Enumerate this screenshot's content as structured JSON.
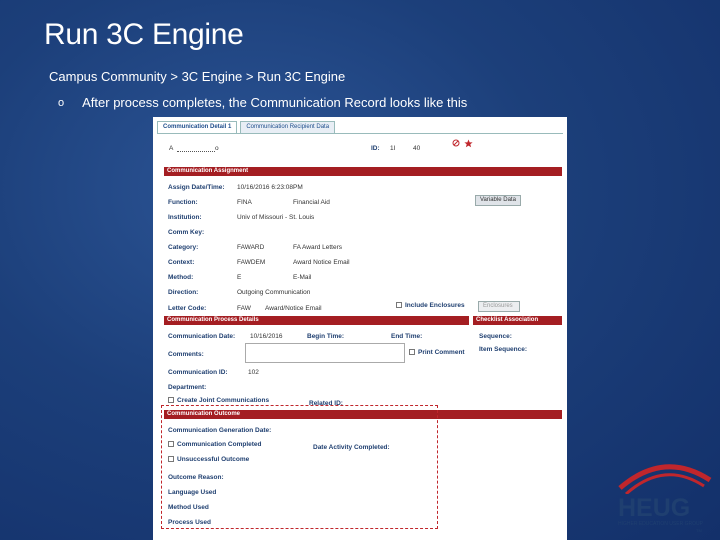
{
  "slide": {
    "title": "Run 3C Engine",
    "breadcrumb": "Campus Community > 3C Engine > Run 3C Engine",
    "bullet_mark": "o",
    "bullet_text": "After process completes, the Communication Record looks like this"
  },
  "tabs": [
    "Communication Detail 1",
    "Communication Recipient Data"
  ],
  "header": {
    "name_start": "A",
    "name_end": "o",
    "id_label": "ID:",
    "id_value_1": "1I",
    "id_value_2": "40"
  },
  "assignment": {
    "section_title": "Communication Assignment",
    "assign_label": "Assign Date/Time:",
    "assign_value": "10/16/2016 6:23:08PM",
    "function_label": "Function:",
    "function_code": "FINA",
    "function_desc": "Financial Aid",
    "institution_label": "Institution:",
    "institution_value": "Univ of Missouri - St. Louis",
    "commkey_label": "Comm Key:",
    "category_label": "Category:",
    "category_code": "FAWARD",
    "category_desc": "FA Award Letters",
    "context_label": "Context:",
    "context_code": "FAWDEM",
    "context_desc": "Award Notice Email",
    "method_label": "Method:",
    "method_code": "E",
    "method_desc": "E-Mail",
    "direction_label": "Direction:",
    "direction_value": "Outgoing Communication",
    "letter_label": "Letter Code:",
    "letter_code": "FAW",
    "letter_desc": "Award/Notice Email",
    "variable_btn": "Variable Data",
    "enclosures_chk": "Include Enclosures",
    "enclosures_btn": "Enclosures"
  },
  "process": {
    "section_title": "Communication Process Details",
    "date_label": "Communication Date:",
    "date_value": "10/16/2016",
    "begin_label": "Begin Time:",
    "end_label": "End Time:",
    "comments_label": "Comments:",
    "print_comment": "Print Comment",
    "id_label": "Communication ID:",
    "id_value": "102",
    "department_label": "Department:",
    "joint_label": "Create Joint Communications",
    "related_label": "Related ID:"
  },
  "checklist": {
    "section_title": "Checklist Association",
    "sequence_label": "Sequence:",
    "item_label": "Item Sequence:"
  },
  "outcome": {
    "section_title": "Communication Outcome",
    "gen_date_label": "Communication Generation Date:",
    "completed_label": "Communication Completed",
    "activity_label": "Date Activity Completed:",
    "unsuccessful_label": "Unsuccessful Outcome",
    "reason_label": "Outcome Reason:",
    "language_label": "Language Used",
    "method_label": "Method Used",
    "process_label": "Process Used"
  },
  "logo": {
    "name": "HEUG",
    "tagline": "HIGHER EDUCATION USER GROUP",
    "tm": "TM"
  },
  "colors": {
    "section_bar": "#a41e22",
    "slide_bg": "#1c3f7a",
    "highlight_box": "#c0262c"
  }
}
